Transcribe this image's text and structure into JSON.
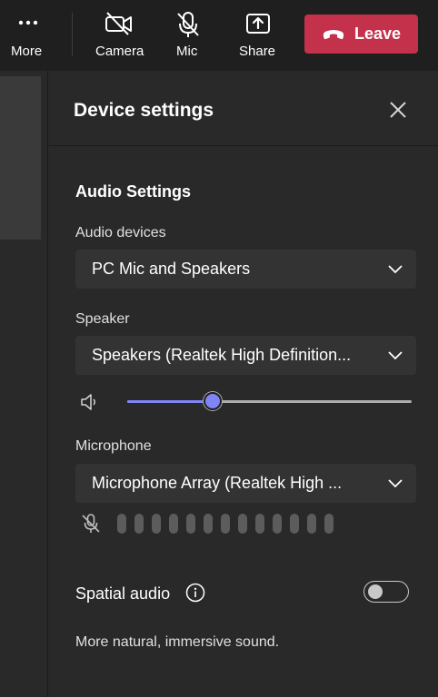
{
  "toolbar": {
    "more_label": "More",
    "camera_label": "Camera",
    "mic_label": "Mic",
    "share_label": "Share",
    "leave_label": "Leave",
    "leave_color": "#c4314b"
  },
  "panel": {
    "title": "Device settings",
    "audio_section_title": "Audio Settings",
    "audio_devices": {
      "label": "Audio devices",
      "value": "PC Mic and Speakers"
    },
    "speaker": {
      "label": "Speaker",
      "value": "Speakers (Realtek High Definition..."
    },
    "speaker_volume": {
      "level_percent": 30,
      "accent_color": "#7f85f5"
    },
    "microphone": {
      "label": "Microphone",
      "value": "Microphone Array (Realtek High ...",
      "level_bar_count": 13
    },
    "spatial_audio": {
      "label": "Spatial audio",
      "enabled": false,
      "description": "More natural, immersive sound."
    }
  },
  "icons": [
    "more-icon",
    "camera-off-icon",
    "mic-off-icon",
    "share-icon",
    "phone-hangup-icon",
    "close-icon",
    "chevron-down-icon",
    "speaker-icon",
    "mic-muted-icon",
    "info-icon"
  ]
}
